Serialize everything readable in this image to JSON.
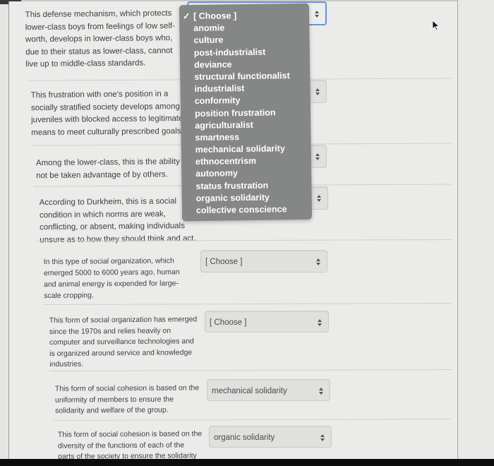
{
  "questions": [
    {
      "text": "This defense mechanism, which protects lower-class boys from feelings of low self-worth, develops in lower-class boys who, due to their status as lower-class, cannot live up to middle-class standards.",
      "lines": [
        "This defense mechanism, which protects",
        "lower-class boys from feelings of low self-",
        "worth, develops in lower-class boys who,",
        "due to their status as lower-class, cannot",
        "live up to middle-class standards."
      ],
      "selected": "[ Choose ]",
      "open": true
    },
    {
      "lines": [
        "This frustration with one's position in a",
        "socially stratified society develops among",
        "juveniles with blocked access to legitimate",
        "means to meet culturally prescribed goals."
      ],
      "selected": "[ Choose ]"
    },
    {
      "lines": [
        "Among the lower-class, this is the ability to",
        "not be taken advantage of by others."
      ],
      "selected": "[ Choose ]"
    },
    {
      "lines": [
        "According to Durkheim, this is a social",
        "condition in which norms are weak,",
        "conflicting, or absent, making individuals",
        "unsure as to how they should think and act."
      ],
      "selected": "[ Choose ]"
    },
    {
      "lines": [
        "In this type of social organization, which",
        "emerged 5000 to 6000 years ago, human",
        "and animal energy is expended for large-",
        "scale cropping."
      ],
      "selected": "[ Choose ]"
    },
    {
      "lines": [
        "This form of social organization has emerged",
        "since the 1970s and relies heavily on",
        "computer and surveillance technologies and",
        "is organized around service and knowledge",
        "industries."
      ],
      "selected": "[ Choose ]"
    },
    {
      "lines": [
        "This form of social cohesion is based on the",
        "uniformity of members to ensure the",
        "solidarity and welfare of the group."
      ],
      "selected": "mechanical solidarity"
    },
    {
      "lines": [
        "This form of social cohesion is based on the",
        "diversity of the functions of each of the",
        "parts of the society to ensure the solidarity"
      ],
      "selected": "organic solidarity"
    }
  ],
  "dropdown": {
    "check_icon": "✓",
    "options": [
      "[ Choose ]",
      "anomie",
      "culture",
      "post-industrialist",
      "deviance",
      "structural functionalist",
      "industrialist",
      "conformity",
      "position frustration",
      "agriculturalist",
      "smartness",
      "mechanical solidarity",
      "ethnocentrism",
      "autonomy",
      "status frustration",
      "organic solidarity",
      "collective conscience"
    ],
    "selected_index": 0
  },
  "colors": {
    "dropdown_bg": "#858686",
    "focus_border": "#6b93d6",
    "text": "#3d3d3d"
  }
}
